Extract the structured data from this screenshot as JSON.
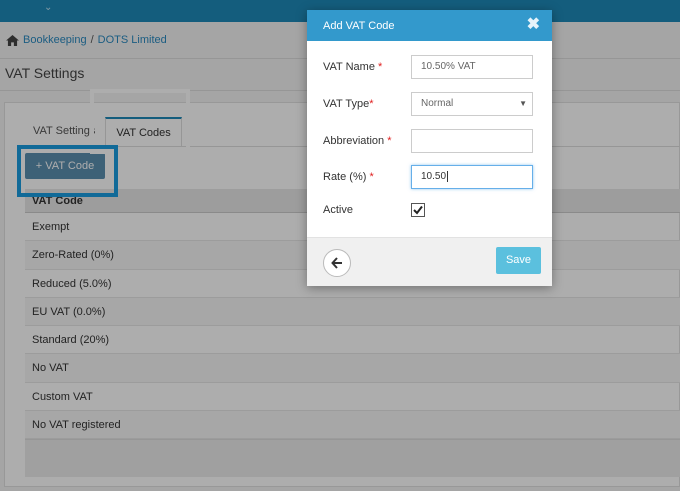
{
  "breadcrumb": {
    "home_icon": "home-icon",
    "item1": "Bookkeeping",
    "separator": "/",
    "item2": "DOTS Limited"
  },
  "page": {
    "title": "VAT Settings"
  },
  "tabs": [
    {
      "label": "VAT Settings"
    },
    {
      "label": "VAT Codes"
    }
  ],
  "add_button": {
    "icon": "plus-icon",
    "label": "+ VAT Code"
  },
  "table": {
    "header": "VAT Code",
    "rows": [
      "Exempt",
      "Zero-Rated (0%)",
      "Reduced (5.0%)",
      "EU VAT (0.0%)",
      "Standard (20%)",
      "No VAT",
      "Custom VAT",
      "No VAT registered"
    ]
  },
  "modal": {
    "title": "Add VAT Code",
    "close_icon": "close-icon",
    "fields": {
      "vat_name": {
        "label": "VAT Name",
        "required_mark": "*",
        "value": "10.50% VAT"
      },
      "vat_type": {
        "label": "VAT Type",
        "required_mark": "*",
        "value": "Normal"
      },
      "abbreviation": {
        "label": "Abbreviation",
        "required_mark": "*",
        "value": ""
      },
      "rate": {
        "label": "Rate (%)",
        "required_mark": "*",
        "value": "10.50"
      },
      "active": {
        "label": "Active",
        "checked": true
      }
    },
    "back_icon": "arrow-left-icon",
    "save_label": "Save"
  },
  "colors": {
    "topbar": "#1e8ab8",
    "modal_header": "#3399cc",
    "save": "#5bc0de",
    "highlight": "#1a9de0",
    "required": "#e02020"
  }
}
